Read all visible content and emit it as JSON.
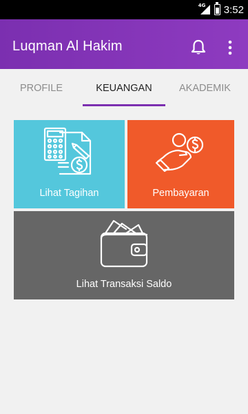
{
  "status_bar": {
    "network": "4G",
    "time": "3:52"
  },
  "app_bar": {
    "title": "Luqman Al Hakim",
    "notification_icon": "bell-icon",
    "menu_icon": "more-vert-icon"
  },
  "tabs": [
    {
      "label": "PROFILE",
      "active": false
    },
    {
      "label": "KEUANGAN",
      "active": true
    },
    {
      "label": "AKADEMIK",
      "active": false
    }
  ],
  "menu": [
    {
      "label": "Lihat Tagihan",
      "icon": "invoice-calculator-icon",
      "color": "#54c7dc"
    },
    {
      "label": "Pembayaran",
      "icon": "hand-coin-icon",
      "color": "#f05a2a"
    },
    {
      "label": "Lihat Transaksi Saldo",
      "icon": "wallet-icon",
      "color": "#666666"
    }
  ],
  "colors": {
    "primary": "#7b2fb0",
    "background": "#f1f1f1"
  }
}
